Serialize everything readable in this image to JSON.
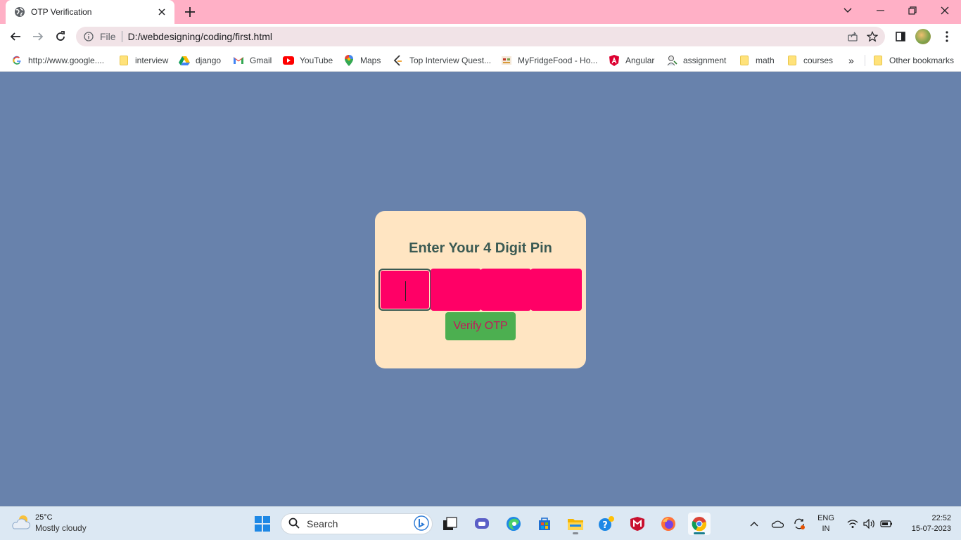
{
  "browser": {
    "tab": {
      "title": "OTP Verification"
    },
    "address": {
      "scheme": "File",
      "url": "D:/webdesigning/coding/first.html"
    },
    "bookmarks": [
      {
        "label": "http://www.google....",
        "icon": "google-icon"
      },
      {
        "label": "interview",
        "icon": "folder-icon"
      },
      {
        "label": "django",
        "icon": "google-drive-icon"
      },
      {
        "label": "Gmail",
        "icon": "gmail-icon"
      },
      {
        "label": "YouTube",
        "icon": "youtube-icon"
      },
      {
        "label": "Maps",
        "icon": "maps-icon"
      },
      {
        "label": "Top Interview Quest...",
        "icon": "leetcode-icon"
      },
      {
        "label": "MyFridgeFood - Ho...",
        "icon": "myfridgefood-icon"
      },
      {
        "label": "Angular",
        "icon": "angular-icon"
      },
      {
        "label": "assignment",
        "icon": "assignment-icon"
      },
      {
        "label": "math",
        "icon": "folder-icon"
      },
      {
        "label": "courses",
        "icon": "folder-icon"
      }
    ],
    "overflow_label": "»",
    "other_bookmarks": "Other bookmarks"
  },
  "page": {
    "title": "Enter Your 4 Digit Pin",
    "otp_values": [
      "",
      "",
      "",
      ""
    ],
    "verify_label": "Verify OTP"
  },
  "taskbar": {
    "weather": {
      "temp": "25°C",
      "condition": "Mostly cloudy"
    },
    "search_label": "Search",
    "language": {
      "line1": "ENG",
      "line2": "IN"
    },
    "clock": {
      "time": "22:52",
      "date": "15-07-2023"
    }
  },
  "colors": {
    "page_bg": "#6882ac",
    "card_bg": "#ffe5c2",
    "otp_box": "#ff0066",
    "title_text": "#3b5a53",
    "verify_bg": "#4caf50",
    "verify_text": "#c2185b",
    "tab_strip": "#ffb0c6"
  }
}
